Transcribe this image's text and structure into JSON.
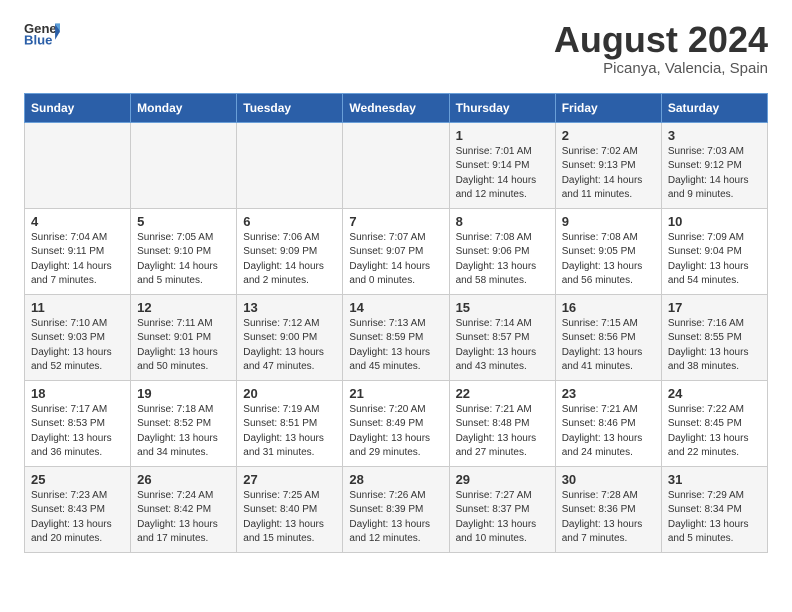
{
  "logo": {
    "general": "General",
    "blue": "Blue"
  },
  "title": "August 2024",
  "subtitle": "Picanya, Valencia, Spain",
  "days_of_week": [
    "Sunday",
    "Monday",
    "Tuesday",
    "Wednesday",
    "Thursday",
    "Friday",
    "Saturday"
  ],
  "weeks": [
    [
      {
        "day": "",
        "info": ""
      },
      {
        "day": "",
        "info": ""
      },
      {
        "day": "",
        "info": ""
      },
      {
        "day": "",
        "info": ""
      },
      {
        "day": "1",
        "info": "Sunrise: 7:01 AM\nSunset: 9:14 PM\nDaylight: 14 hours\nand 12 minutes."
      },
      {
        "day": "2",
        "info": "Sunrise: 7:02 AM\nSunset: 9:13 PM\nDaylight: 14 hours\nand 11 minutes."
      },
      {
        "day": "3",
        "info": "Sunrise: 7:03 AM\nSunset: 9:12 PM\nDaylight: 14 hours\nand 9 minutes."
      }
    ],
    [
      {
        "day": "4",
        "info": "Sunrise: 7:04 AM\nSunset: 9:11 PM\nDaylight: 14 hours\nand 7 minutes."
      },
      {
        "day": "5",
        "info": "Sunrise: 7:05 AM\nSunset: 9:10 PM\nDaylight: 14 hours\nand 5 minutes."
      },
      {
        "day": "6",
        "info": "Sunrise: 7:06 AM\nSunset: 9:09 PM\nDaylight: 14 hours\nand 2 minutes."
      },
      {
        "day": "7",
        "info": "Sunrise: 7:07 AM\nSunset: 9:07 PM\nDaylight: 14 hours\nand 0 minutes."
      },
      {
        "day": "8",
        "info": "Sunrise: 7:08 AM\nSunset: 9:06 PM\nDaylight: 13 hours\nand 58 minutes."
      },
      {
        "day": "9",
        "info": "Sunrise: 7:08 AM\nSunset: 9:05 PM\nDaylight: 13 hours\nand 56 minutes."
      },
      {
        "day": "10",
        "info": "Sunrise: 7:09 AM\nSunset: 9:04 PM\nDaylight: 13 hours\nand 54 minutes."
      }
    ],
    [
      {
        "day": "11",
        "info": "Sunrise: 7:10 AM\nSunset: 9:03 PM\nDaylight: 13 hours\nand 52 minutes."
      },
      {
        "day": "12",
        "info": "Sunrise: 7:11 AM\nSunset: 9:01 PM\nDaylight: 13 hours\nand 50 minutes."
      },
      {
        "day": "13",
        "info": "Sunrise: 7:12 AM\nSunset: 9:00 PM\nDaylight: 13 hours\nand 47 minutes."
      },
      {
        "day": "14",
        "info": "Sunrise: 7:13 AM\nSunset: 8:59 PM\nDaylight: 13 hours\nand 45 minutes."
      },
      {
        "day": "15",
        "info": "Sunrise: 7:14 AM\nSunset: 8:57 PM\nDaylight: 13 hours\nand 43 minutes."
      },
      {
        "day": "16",
        "info": "Sunrise: 7:15 AM\nSunset: 8:56 PM\nDaylight: 13 hours\nand 41 minutes."
      },
      {
        "day": "17",
        "info": "Sunrise: 7:16 AM\nSunset: 8:55 PM\nDaylight: 13 hours\nand 38 minutes."
      }
    ],
    [
      {
        "day": "18",
        "info": "Sunrise: 7:17 AM\nSunset: 8:53 PM\nDaylight: 13 hours\nand 36 minutes."
      },
      {
        "day": "19",
        "info": "Sunrise: 7:18 AM\nSunset: 8:52 PM\nDaylight: 13 hours\nand 34 minutes."
      },
      {
        "day": "20",
        "info": "Sunrise: 7:19 AM\nSunset: 8:51 PM\nDaylight: 13 hours\nand 31 minutes."
      },
      {
        "day": "21",
        "info": "Sunrise: 7:20 AM\nSunset: 8:49 PM\nDaylight: 13 hours\nand 29 minutes."
      },
      {
        "day": "22",
        "info": "Sunrise: 7:21 AM\nSunset: 8:48 PM\nDaylight: 13 hours\nand 27 minutes."
      },
      {
        "day": "23",
        "info": "Sunrise: 7:21 AM\nSunset: 8:46 PM\nDaylight: 13 hours\nand 24 minutes."
      },
      {
        "day": "24",
        "info": "Sunrise: 7:22 AM\nSunset: 8:45 PM\nDaylight: 13 hours\nand 22 minutes."
      }
    ],
    [
      {
        "day": "25",
        "info": "Sunrise: 7:23 AM\nSunset: 8:43 PM\nDaylight: 13 hours\nand 20 minutes."
      },
      {
        "day": "26",
        "info": "Sunrise: 7:24 AM\nSunset: 8:42 PM\nDaylight: 13 hours\nand 17 minutes."
      },
      {
        "day": "27",
        "info": "Sunrise: 7:25 AM\nSunset: 8:40 PM\nDaylight: 13 hours\nand 15 minutes."
      },
      {
        "day": "28",
        "info": "Sunrise: 7:26 AM\nSunset: 8:39 PM\nDaylight: 13 hours\nand 12 minutes."
      },
      {
        "day": "29",
        "info": "Sunrise: 7:27 AM\nSunset: 8:37 PM\nDaylight: 13 hours\nand 10 minutes."
      },
      {
        "day": "30",
        "info": "Sunrise: 7:28 AM\nSunset: 8:36 PM\nDaylight: 13 hours\nand 7 minutes."
      },
      {
        "day": "31",
        "info": "Sunrise: 7:29 AM\nSunset: 8:34 PM\nDaylight: 13 hours\nand 5 minutes."
      }
    ]
  ]
}
